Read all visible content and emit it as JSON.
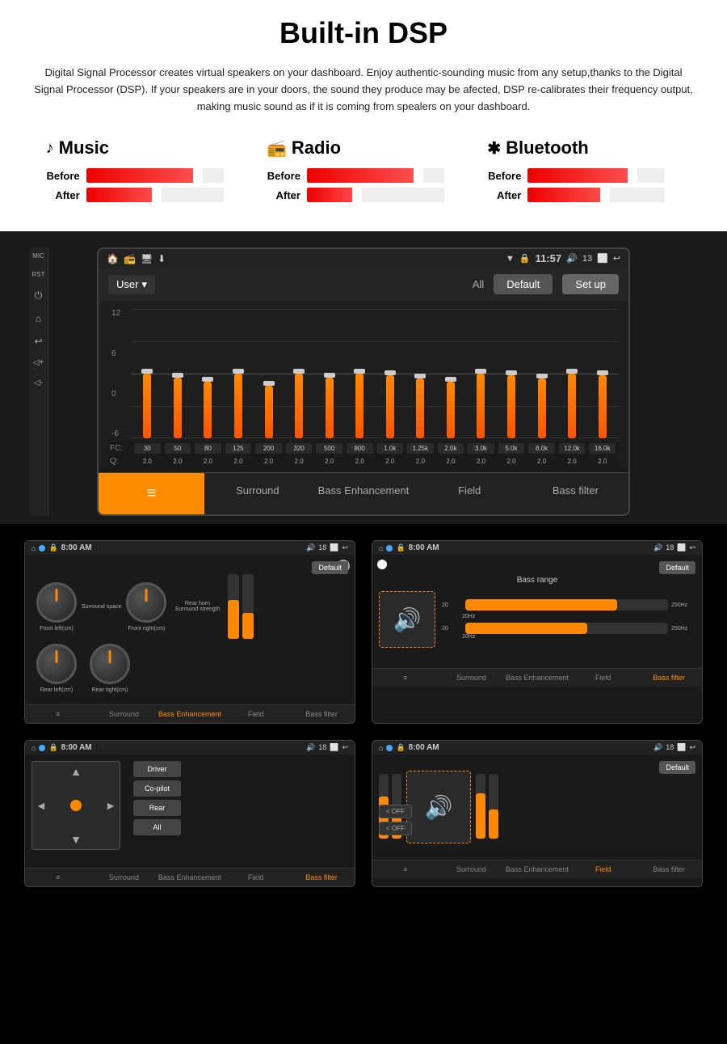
{
  "page": {
    "title": "Built-in DSP",
    "description": "Digital Signal Processor creates virtual speakers on your dashboard.\nEnjoy authentic-sounding music from any setup,thanks to the Digital Signal Processor (DSP). If your speakers are in your doors, the sound they produce may be afected, DSP re-calibrates their frequency output, making music sound as if it is coming from spealers on your dashboard."
  },
  "comparison": {
    "columns": [
      {
        "icon": "♪",
        "title": "Music",
        "before_width": 85,
        "after_width": 55
      },
      {
        "icon": "📻",
        "title": "Radio",
        "before_width": 85,
        "after_width": 40
      },
      {
        "icon": "✱",
        "title": "Bluetooth",
        "before_width": 80,
        "after_width": 60
      }
    ],
    "before_label": "Before",
    "after_label": "After"
  },
  "dsp_screen": {
    "mic_label": "MIC",
    "rst_label": "RST",
    "time": "11:57",
    "battery": "13",
    "preset": "User",
    "all_label": "All",
    "default_btn": "Default",
    "setup_btn": "Set up",
    "db_labels": [
      "12",
      "6",
      "0",
      "-6"
    ],
    "frequencies": [
      "30",
      "50",
      "80",
      "125",
      "200",
      "320",
      "500",
      "800",
      "1.0k",
      "1.25k",
      "2.0k",
      "3.0k",
      "5.0k",
      "8.0k",
      "12.0k",
      "16.0k"
    ],
    "q_values": [
      "2.0",
      "2.0",
      "2.0",
      "2.0",
      "2.0",
      "2.0",
      "2.0",
      "2.0",
      "2.0",
      "2.0",
      "2.0",
      "2.0",
      "2.0",
      "2.0",
      "2.0",
      "2.0"
    ],
    "fc_label": "FC:",
    "q_label": "Q:",
    "bar_positions": [
      55,
      60,
      65,
      50,
      70,
      55,
      60,
      50,
      55,
      60,
      65,
      50,
      55,
      60,
      55,
      50
    ],
    "handle_positions": [
      55,
      60,
      65,
      50,
      70,
      55,
      60,
      50,
      55,
      60,
      65,
      50,
      55,
      60,
      55,
      50
    ],
    "tabs": [
      {
        "label": "≡≡≡",
        "icon": true,
        "active": true
      },
      {
        "label": "Surround",
        "active": false
      },
      {
        "label": "Bass Enhancement",
        "active": false
      },
      {
        "label": "Field",
        "active": false
      },
      {
        "label": "Bass filter",
        "active": false
      }
    ]
  },
  "quad_screens": [
    {
      "id": "surround",
      "time": "8:00 AM",
      "battery": "18",
      "default_btn": "Default",
      "active_tab": "Bass Enhancement",
      "tabs": [
        "≡",
        "Surround",
        "Bass Enhancement",
        "Field",
        "Bass filter"
      ],
      "dials": [
        "Front left(cm)",
        "Front right(cm)",
        "Rear left(cm)",
        "Rear right(cm)"
      ],
      "labels": [
        "Surround space",
        "Rear horn Surround strength"
      ]
    },
    {
      "id": "bass-range",
      "time": "8:00 AM",
      "battery": "18",
      "default_btn": "Default",
      "active_tab": "Bass filter",
      "title": "Bass range",
      "tabs": [
        "≡",
        "Surround",
        "Bass Enhancement",
        "Field",
        "Bass filter"
      ],
      "sliders": [
        {
          "label": "20Hz",
          "end_label": "250Hz",
          "width": 75
        },
        {
          "label": "20Hz",
          "end_label": "250Hz",
          "width": 60
        }
      ]
    },
    {
      "id": "field",
      "time": "8:00 AM",
      "battery": "18",
      "active_tab": "Bass filter",
      "tabs": [
        "≡",
        "Surround",
        "Bass Enhancement",
        "Field",
        "Bass filter"
      ],
      "buttons": [
        "Driver",
        "Co-pilot",
        "Rear",
        "All"
      ]
    },
    {
      "id": "bass-filter",
      "time": "8:00 AM",
      "battery": "18",
      "default_btn": "Default",
      "active_tab": "Field",
      "tabs": [
        "≡",
        "Surround",
        "Bass Enhancement",
        "Field",
        "Bass filter"
      ],
      "off_label": "< OFF"
    }
  ]
}
